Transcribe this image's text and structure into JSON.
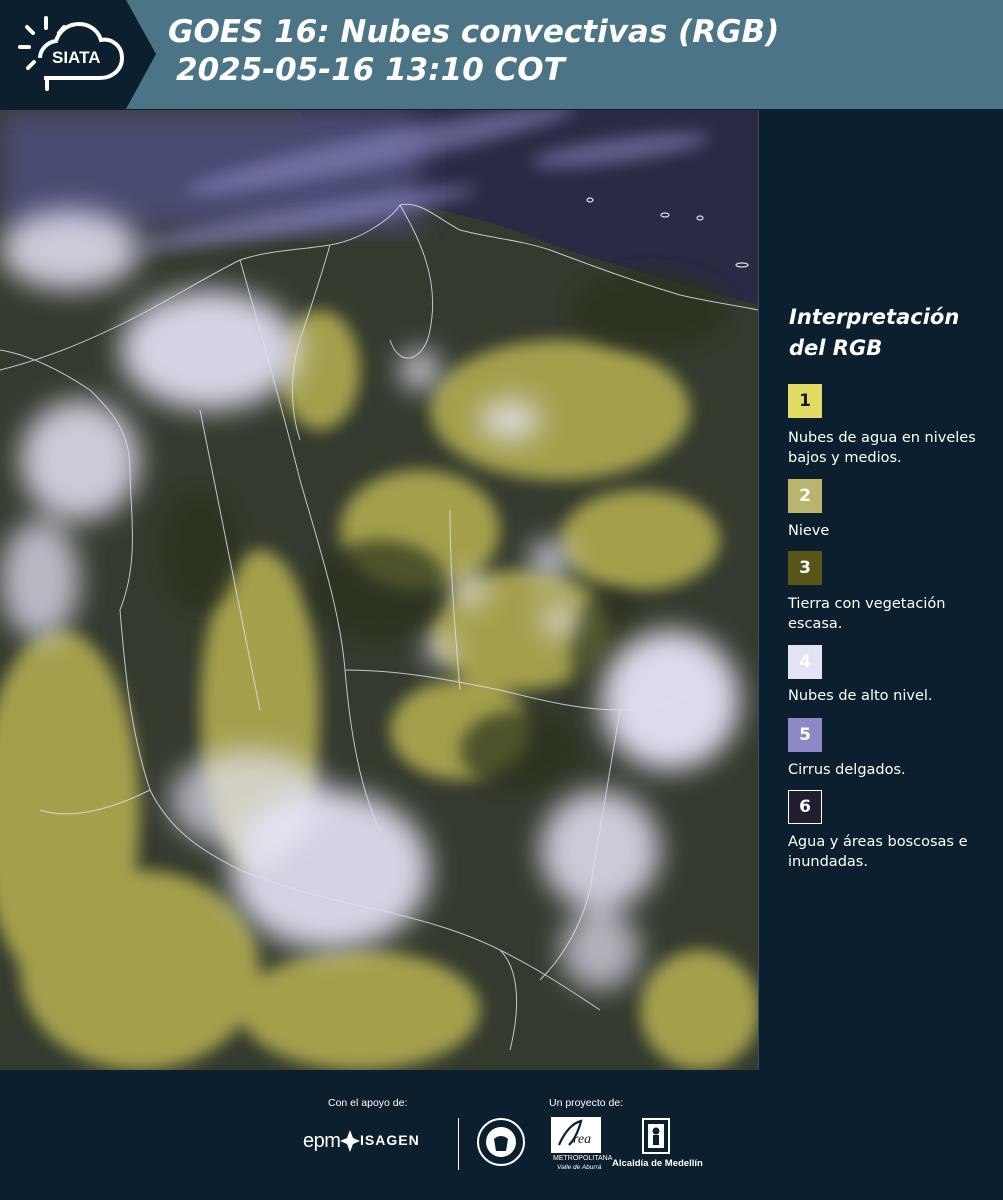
{
  "header": {
    "logo_text": "SIATA",
    "title_line1": "GOES 16: Nubes convectivas (RGB)",
    "title_line2": "2025-05-16 13:10 COT"
  },
  "colors": {
    "header_bg": "#4b7487",
    "panel_bg": "#0c1f2e",
    "accent_text": "#ffffff"
  },
  "legend": {
    "title": "Interpretación del RGB",
    "items": [
      {
        "number": "1",
        "color": "#e2db63",
        "text_color": "#1a1a1a",
        "label": "Nubes de agua en niveles bajos y medios."
      },
      {
        "number": "2",
        "color": "#b9b56e",
        "text_color": "#ffffff",
        "label": "Nieve"
      },
      {
        "number": "3",
        "color": "#575517",
        "text_color": "#ffffff",
        "label": "Tierra con vegetación escasa."
      },
      {
        "number": "4",
        "color": "#e3e2f6",
        "text_color": "#ffffff",
        "label": "Nubes de alto nivel."
      },
      {
        "number": "5",
        "color": "#8c8ac6",
        "text_color": "#ffffff",
        "label": "Cirrus delgados."
      },
      {
        "number": "6",
        "color": "#211e31",
        "text_color": "#ffffff",
        "label": "Agua y áreas boscosas e inundadas."
      }
    ]
  },
  "footer": {
    "support_caption": "Con el apoyo de:",
    "project_caption": "Un proyecto de:",
    "sponsor_epm": "epm",
    "sponsor_isagen": "ISAGEN",
    "emblem_metropolitana": "METROPOLITANA",
    "emblem_valle": "Valle de Aburrá",
    "emblem_alcaldia": "Alcaldía de Medellín"
  }
}
